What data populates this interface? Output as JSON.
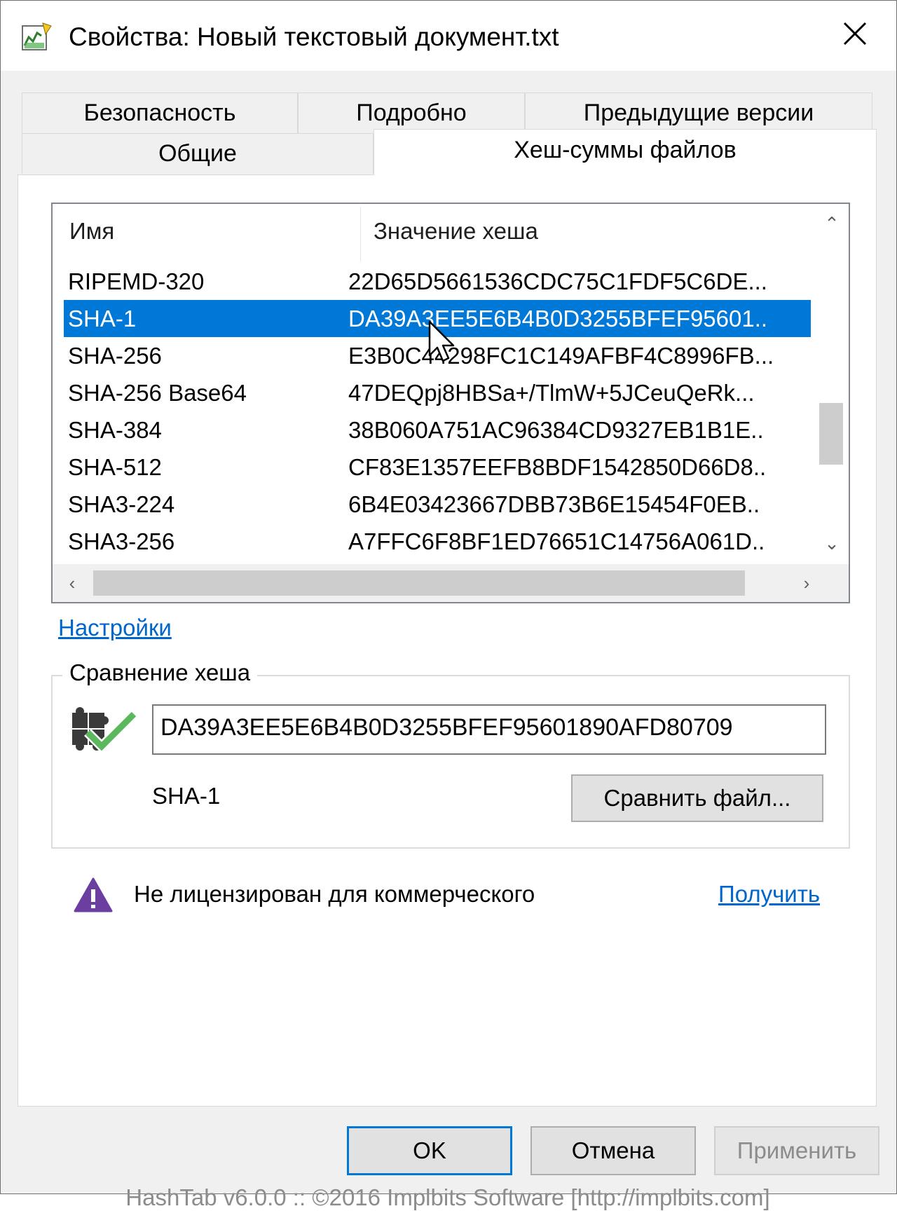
{
  "window": {
    "title": "Свойства: Новый текстовый документ.txt",
    "close_icon": "close-icon"
  },
  "tabs": {
    "security": "Безопасность",
    "details": "Подробно",
    "previous_versions": "Предыдущие версии",
    "general": "Общие",
    "hash_sums": "Хеш-суммы файлов"
  },
  "hash_list": {
    "columns": [
      "Имя",
      "Значение хеша"
    ],
    "rows": [
      {
        "name": "RIPEMD-320",
        "value": "22D65D5661536CDC75C1FDF5C6DE..."
      },
      {
        "name": "SHA-1",
        "value": "DA39A3EE5E6B4B0D3255BFEF95601.."
      },
      {
        "name": "SHA-256",
        "value": "E3B0C44298FC1C149AFBF4C8996FB..."
      },
      {
        "name": "SHA-256 Base64",
        "value": "47DEQpj8HBSa+/TlmW+5JCeuQeRk..."
      },
      {
        "name": "SHA-384",
        "value": "38B060A751AC96384CD9327EB1B1E.."
      },
      {
        "name": "SHA-512",
        "value": "CF83E1357EEFB8BDF1542850D66D8.."
      },
      {
        "name": "SHA3-224",
        "value": "6B4E03423667DBB73B6E15454F0EB.."
      },
      {
        "name": "SHA3-256",
        "value": "A7FFC6F8BF1ED76651C14756A061D.."
      }
    ],
    "selected_index": 1
  },
  "settings_link": "Настройки",
  "compare": {
    "group_title": "Сравнение хеша",
    "hash_value": "DA39A3EE5E6B4B0D3255BFEF95601890AFD80709",
    "algorithm": "SHA-1",
    "compare_button": "Сравнить файл..."
  },
  "license": {
    "text": "Не лицензирован для коммерческого",
    "get_link": "Получить"
  },
  "footer": "HashTab v6.0.0 :: ©2016 Implbits Software [http://implbits.com]",
  "buttons": {
    "ok": "OK",
    "cancel": "Отмена",
    "apply": "Применить"
  },
  "colors": {
    "selection": "#0078d7",
    "link": "#0066cc",
    "warning": "#6b3fa0"
  }
}
